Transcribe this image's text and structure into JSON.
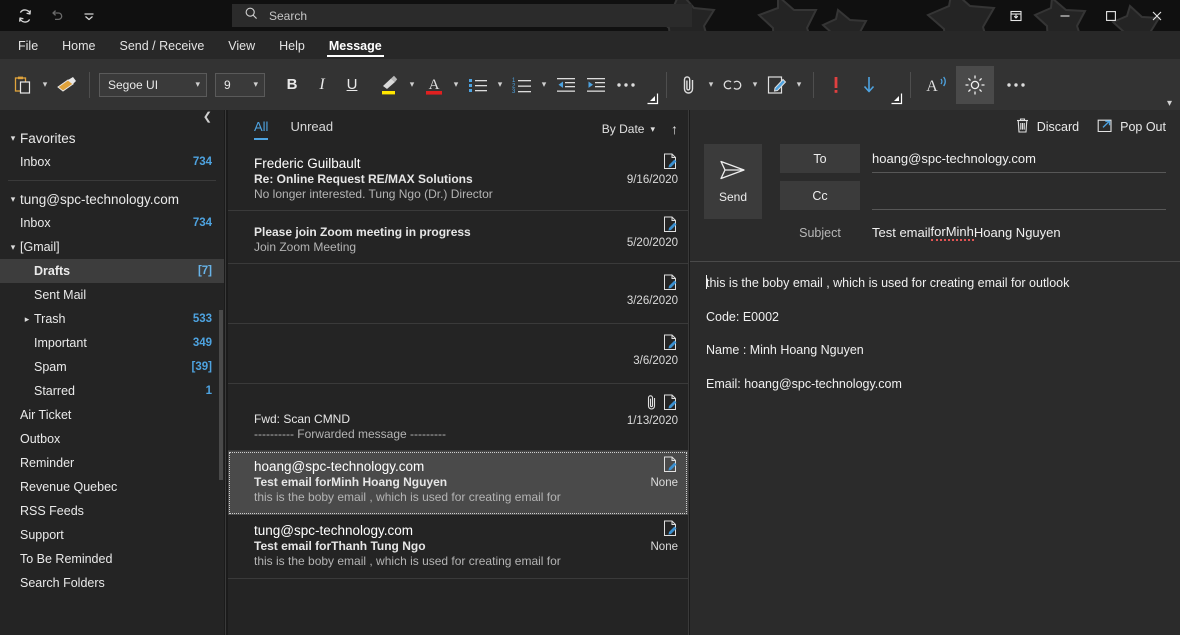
{
  "titlebar": {
    "quick_access": [
      {
        "name": "sync-icon",
        "label": "Send/Receive All Folders"
      },
      {
        "name": "undo-icon",
        "label": "Undo"
      },
      {
        "name": "chevron-down-icon",
        "label": "Customize Quick Access Toolbar"
      }
    ],
    "search_placeholder": "Search",
    "search_value": "",
    "window_controls": [
      {
        "name": "restore-down-icon",
        "glyph": "⍗"
      },
      {
        "name": "minimize-icon",
        "glyph": "—"
      },
      {
        "name": "maximize-icon",
        "glyph": "☐"
      },
      {
        "name": "close-icon",
        "glyph": "✕"
      }
    ]
  },
  "menu": {
    "tabs": [
      {
        "label": "File",
        "active": false
      },
      {
        "label": "Home",
        "active": false
      },
      {
        "label": "Send / Receive",
        "active": false
      },
      {
        "label": "View",
        "active": false
      },
      {
        "label": "Help",
        "active": false
      },
      {
        "label": "Message",
        "active": true
      }
    ]
  },
  "ribbon": {
    "paste_icon": "paste-icon",
    "format_painter_icon": "format-painter-icon",
    "font_family": "Segoe UI",
    "font_size": "9",
    "bold_label": "B",
    "italic_label": "I",
    "underline_label": "U",
    "highlight_icon": "text-highlight-icon",
    "fontcolor_icon": "font-color-icon",
    "bullets_icon": "bullet-list-icon",
    "numbering_icon": "numbered-list-icon",
    "decrease_indent_icon": "decrease-indent-icon",
    "increase_indent_icon": "increase-indent-icon",
    "more_format_icon": "more-formatting-icon",
    "attach_icon": "attach-file-icon",
    "link_icon": "insert-link-icon",
    "signature_icon": "signature-icon",
    "high_importance_icon": "high-importance-icon",
    "low_importance_icon": "low-importance-icon",
    "read_aloud_icon": "read-aloud-icon",
    "immersive_icon": "immersive-reader-icon",
    "overflow_icon": "more-commands-icon",
    "collapse_icon": "collapse-ribbon-icon"
  },
  "sidebar": {
    "collapse_icon": "collapse-pane-icon",
    "groups": [
      {
        "name": "Favorites",
        "expanded": true,
        "items": [
          {
            "label": "Inbox",
            "count": "734",
            "indent": 1,
            "selected": false,
            "chevron": ""
          }
        ]
      },
      {
        "name": "tung@spc-technology.com",
        "expanded": true,
        "items": [
          {
            "label": "Inbox",
            "count": "734",
            "indent": 1,
            "selected": false,
            "chevron": ""
          },
          {
            "label": "[Gmail]",
            "count": "",
            "indent": 1,
            "selected": false,
            "chevron": "down"
          },
          {
            "label": "Drafts",
            "count": "[7]",
            "indent": 2,
            "selected": true,
            "chevron": ""
          },
          {
            "label": "Sent Mail",
            "count": "",
            "indent": 2,
            "selected": false,
            "chevron": ""
          },
          {
            "label": "Trash",
            "count": "533",
            "indent": 2,
            "selected": false,
            "chevron": "right"
          },
          {
            "label": "Important",
            "count": "349",
            "indent": 2,
            "selected": false,
            "chevron": ""
          },
          {
            "label": "Spam",
            "count": "[39]",
            "indent": 2,
            "selected": false,
            "chevron": ""
          },
          {
            "label": "Starred",
            "count": "1",
            "indent": 2,
            "selected": false,
            "chevron": ""
          },
          {
            "label": "Air Ticket",
            "count": "",
            "indent": 1,
            "selected": false,
            "chevron": ""
          },
          {
            "label": "Outbox",
            "count": "",
            "indent": 1,
            "selected": false,
            "chevron": ""
          },
          {
            "label": "Reminder",
            "count": "",
            "indent": 1,
            "selected": false,
            "chevron": ""
          },
          {
            "label": "Revenue Quebec",
            "count": "",
            "indent": 1,
            "selected": false,
            "chevron": ""
          },
          {
            "label": "RSS Feeds",
            "count": "",
            "indent": 1,
            "selected": false,
            "chevron": ""
          },
          {
            "label": "Support",
            "count": "",
            "indent": 1,
            "selected": false,
            "chevron": ""
          },
          {
            "label": "To Be Reminded",
            "count": "",
            "indent": 1,
            "selected": false,
            "chevron": ""
          },
          {
            "label": "Search Folders",
            "count": "",
            "indent": 1,
            "selected": false,
            "chevron": ""
          }
        ]
      }
    ]
  },
  "message_list": {
    "filters": [
      {
        "label": "All",
        "active": true
      },
      {
        "label": "Unread",
        "active": false
      }
    ],
    "sort_label": "By Date",
    "sort_direction_icon": "sort-ascending-icon",
    "rows": [
      {
        "from": "Frederic Guilbault",
        "subject": "Re: Online Request RE/MAX Solutions",
        "preview": "No longer interested.   Tung Ngo (Dr.)  Director",
        "date": "9/16/2020",
        "icons": [
          "draft-icon"
        ],
        "selected": false
      },
      {
        "from": "",
        "subject": "Please join Zoom meeting in progress",
        "preview": "Join Zoom Meeting",
        "date": "5/20/2020",
        "icons": [
          "draft-icon"
        ],
        "selected": false
      },
      {
        "from": "",
        "subject": "",
        "preview": "",
        "date": "3/26/2020",
        "icons": [
          "draft-icon"
        ],
        "selected": false
      },
      {
        "from": "",
        "subject": "",
        "preview": "",
        "date": "3/6/2020",
        "icons": [
          "draft-icon"
        ],
        "selected": false
      },
      {
        "from": "",
        "subject": "Fwd: Scan CMND",
        "preview": "---------- Forwarded message ---------",
        "date": "1/13/2020",
        "icons": [
          "attachment-icon",
          "draft-icon"
        ],
        "selected": false
      },
      {
        "from": "hoang@spc-technology.com",
        "subject": "Test email forMinh Hoang Nguyen",
        "preview": "this is the boby email , which is used for creating email for",
        "date": "None",
        "icons": [
          "draft-icon"
        ],
        "selected": true
      },
      {
        "from": "tung@spc-technology.com",
        "subject": "Test email forThanh Tung Ngo",
        "preview": "this is the boby email , which is used for creating email for",
        "date": "None",
        "icons": [
          "draft-icon"
        ],
        "selected": false
      }
    ]
  },
  "compose": {
    "discard_label": "Discard",
    "discard_icon": "trash-icon",
    "popout_label": "Pop Out",
    "popout_icon": "pop-out-icon",
    "send_label": "Send",
    "send_icon": "send-icon",
    "to_label": "To",
    "to_value": "hoang@spc-technology.com",
    "cc_label": "Cc",
    "cc_value": "",
    "subject_label": "Subject",
    "subject_prefix": "Test email ",
    "subject_misspelled": "forMinh",
    "subject_suffix": " Hoang Nguyen",
    "body": [
      "this is the boby email , which is used for creating email for outlook",
      "Code: E0002",
      "Name :  Minh Hoang  Nguyen",
      "Email: hoang@spc-technology.com"
    ]
  },
  "colors": {
    "accent_blue": "#4ea3e0",
    "titlebar_bg": "#101010",
    "ribbon_bg": "#333333",
    "pane_bg": "#242424",
    "compose_bg": "#2b2b2b",
    "selection_bg": "#4a4a4a",
    "error_red": "#e05555",
    "highlight_yellow": "#ffe600"
  }
}
